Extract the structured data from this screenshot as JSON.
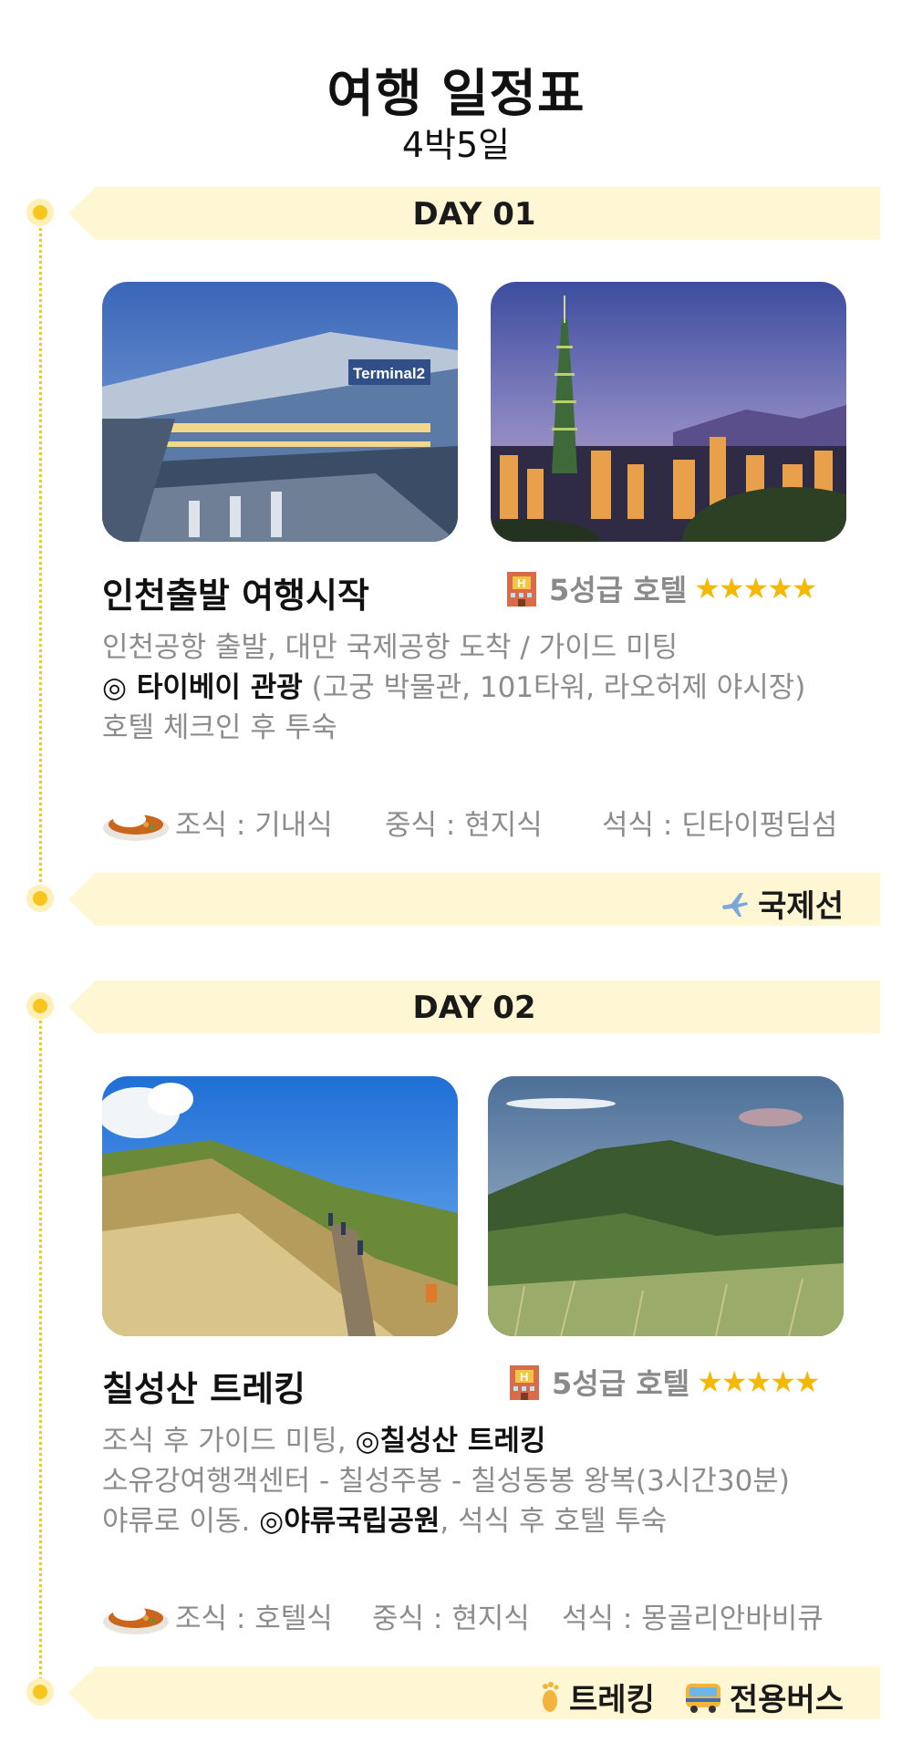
{
  "header": {
    "title": "여행 일정표",
    "subtitle": "4박5일"
  },
  "days": [
    {
      "label": "DAY 01",
      "place": "인천출발 여행시작",
      "hotel": "5성급 호텔",
      "stars": "★★★★★",
      "desc": {
        "line1": "인천공항 출발, 대만 국제공항 도착 / 가이드 미팅",
        "line2_bold": "◎ 타이베이 관광",
        "line2_rest": " (고궁 박물관, 101타워, 라오허제 야시장)",
        "line3": "호텔 체크인 후 투숙"
      },
      "meals": {
        "breakfast": "조식 : 기내식",
        "lunch": "중식 : 현지식",
        "dinner": "석식 : 딘타이펑딤섬"
      },
      "transport": [
        "국제선"
      ],
      "photos": [
        "airport-terminal-photo",
        "taipei-101-night-photo"
      ],
      "photo_text": [
        "Terminal2"
      ]
    },
    {
      "label": "DAY 02",
      "place": "칠성산 트레킹",
      "hotel": "5성급 호텔",
      "stars": "★★★★★",
      "desc": {
        "line1_a": "조식 후 가이드 미팅, ",
        "line1_bold": "◎칠성산 트레킹",
        "line2": "소유강여행객센터 - 칠성주봉 - 칠성동봉 왕복(3시간30분)",
        "line3_a": "야류로 이동. ",
        "line3_bold": "◎야류국립공원",
        "line3_b": ", 석식 후 호텔 투숙"
      },
      "meals": {
        "breakfast": "조식 : 호텔식",
        "lunch": "중식 : 현지식",
        "dinner": "석식 : 몽골리안바비큐"
      },
      "transport": [
        "트레킹",
        "전용버스"
      ],
      "photos": [
        "mountain-trail-hikers-photo",
        "green-mountain-range-photo"
      ]
    }
  ],
  "colors": {
    "accent": "#f7c51e",
    "banner": "#fff6d3",
    "star": "#f5b800"
  },
  "icons": [
    "hotel-icon",
    "curry-rice-icon",
    "airplane-icon",
    "footprint-icon",
    "bus-icon"
  ]
}
